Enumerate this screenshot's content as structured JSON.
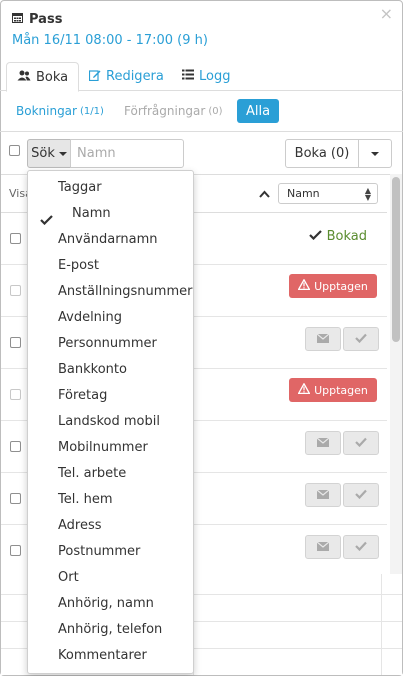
{
  "header": {
    "title": "Pass",
    "subtitle": "Mån 16/11 08:00 - 17:00 (9 h)",
    "close_symbol": "×"
  },
  "tabs": [
    {
      "label": "Boka",
      "icon": "user-group-icon",
      "active": true
    },
    {
      "label": "Redigera",
      "icon": "edit-icon",
      "active": false
    },
    {
      "label": "Logg",
      "icon": "list-icon",
      "active": false
    }
  ],
  "filters": {
    "bokningar": {
      "label": "Bokningar",
      "count": "(1/1)"
    },
    "forfragningar": {
      "label": "Förfrågningar",
      "count": "(0)"
    },
    "alla": {
      "label": "Alla"
    }
  },
  "toolbar": {
    "search_mode_label": "Sök",
    "search_placeholder": "Namn",
    "boka_label": "Boka (0)"
  },
  "list": {
    "visa_label": "Visa",
    "sort_value": "Namn",
    "rows": [
      {
        "status": "Bokad"
      },
      {
        "status": "Upptagen"
      },
      {
        "status": "actions"
      },
      {
        "status": "Upptagen"
      },
      {
        "status": "actions"
      },
      {
        "status": "actions"
      },
      {
        "status": "actions"
      }
    ]
  },
  "dropdown": {
    "items": [
      {
        "label": "Taggar",
        "checked": false
      },
      {
        "label": "Namn",
        "checked": true
      },
      {
        "label": "Användarnamn",
        "checked": false
      },
      {
        "label": "E-post",
        "checked": false
      },
      {
        "label": "Anställningsnummer",
        "checked": false
      },
      {
        "label": "Avdelning",
        "checked": false
      },
      {
        "label": "Personnummer",
        "checked": false
      },
      {
        "label": "Bankkonto",
        "checked": false
      },
      {
        "label": "Företag",
        "checked": false
      },
      {
        "label": "Landskod mobil",
        "checked": false
      },
      {
        "label": "Mobilnummer",
        "checked": false
      },
      {
        "label": "Tel. arbete",
        "checked": false
      },
      {
        "label": "Tel. hem",
        "checked": false
      },
      {
        "label": "Adress",
        "checked": false
      },
      {
        "label": "Postnummer",
        "checked": false
      },
      {
        "label": "Ort",
        "checked": false
      },
      {
        "label": "Anhörig, namn",
        "checked": false
      },
      {
        "label": "Anhörig, telefon",
        "checked": false
      },
      {
        "label": "Kommentarer",
        "checked": false
      }
    ]
  },
  "colors": {
    "accent": "#2a9fd6",
    "booked": "#5a8c2f",
    "busy": "#e06666"
  }
}
